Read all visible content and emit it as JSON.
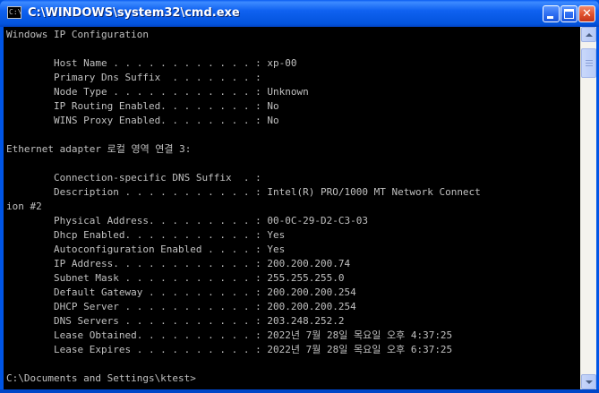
{
  "window": {
    "title": "C:\\WINDOWS\\system32\\cmd.exe",
    "icon": "cmd-icon",
    "controls": {
      "minimize": "minimize-icon",
      "maximize": "maximize-icon",
      "close": "close-icon"
    }
  },
  "console": {
    "lines": [
      "Windows IP Configuration",
      "",
      "        Host Name . . . . . . . . . . . . : xp-00",
      "        Primary Dns Suffix  . . . . . . . :",
      "        Node Type . . . . . . . . . . . . : Unknown",
      "        IP Routing Enabled. . . . . . . . : No",
      "        WINS Proxy Enabled. . . . . . . . : No",
      "",
      "Ethernet adapter 로컬 영역 연결 3:",
      "",
      "        Connection-specific DNS Suffix  . :",
      "        Description . . . . . . . . . . . : Intel(R) PRO/1000 MT Network Connect",
      "ion #2",
      "        Physical Address. . . . . . . . . : 00-0C-29-D2-C3-03",
      "        Dhcp Enabled. . . . . . . . . . . : Yes",
      "        Autoconfiguration Enabled . . . . : Yes",
      "        IP Address. . . . . . . . . . . . : 200.200.200.74",
      "        Subnet Mask . . . . . . . . . . . : 255.255.255.0",
      "        Default Gateway . . . . . . . . . : 200.200.200.254",
      "        DHCP Server . . . . . . . . . . . : 200.200.200.254",
      "        DNS Servers . . . . . . . . . . . : 203.248.252.2",
      "        Lease Obtained. . . . . . . . . . : 2022년 7월 28일 목요일 오후 4:37:25",
      "        Lease Expires . . . . . . . . . . : 2022년 7월 28일 목요일 오후 6:37:25",
      "",
      "C:\\Documents and Settings\\ktest>"
    ]
  },
  "colors": {
    "title_bar": "#0054e3",
    "console_bg": "#000000",
    "console_text": "#c0c0c0",
    "close_button": "#e2542f"
  }
}
